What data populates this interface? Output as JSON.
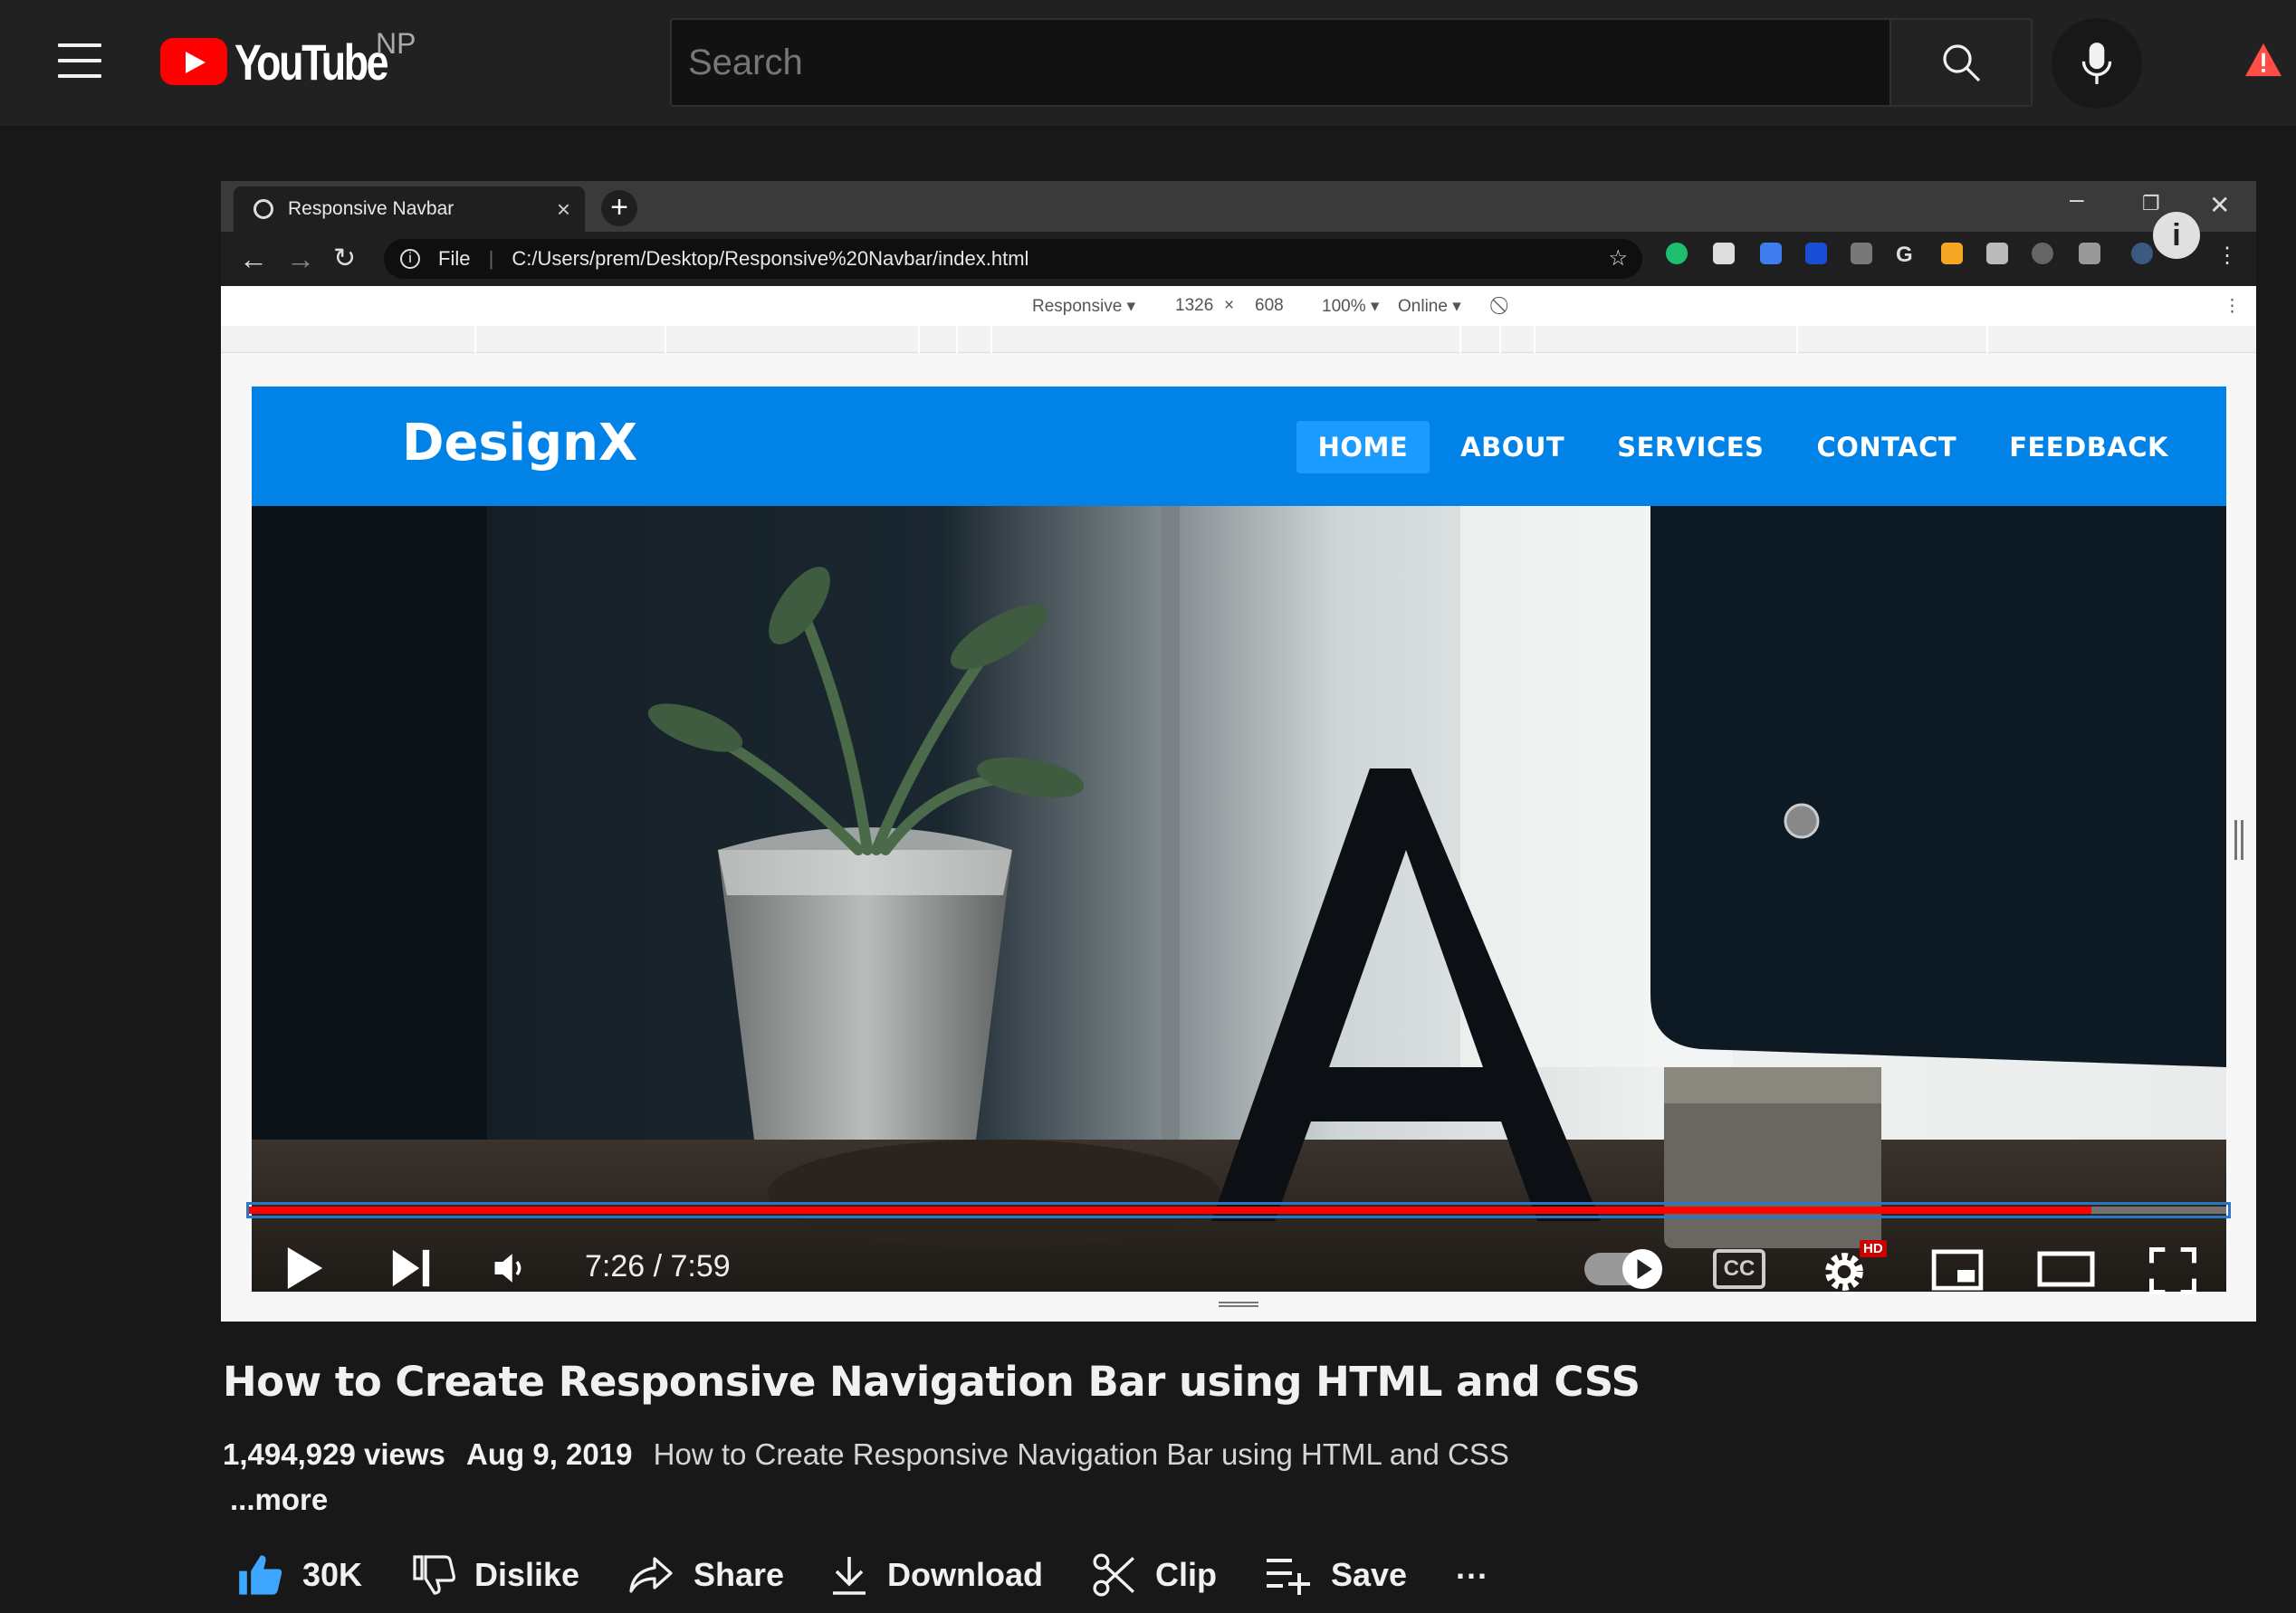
{
  "header": {
    "logo_text": "YouTube",
    "country_code": "NP",
    "search_placeholder": "Search"
  },
  "embedded_browser": {
    "tab_title": "Responsive Navbar",
    "url_prefix": "File",
    "url": "C:/Users/prem/Desktop/Responsive%20Navbar/index.html",
    "device_mode": "Responsive",
    "width": "1326",
    "times": "×",
    "height": "608",
    "zoom": "100%",
    "network": "Online"
  },
  "site": {
    "brand": "DesignX",
    "menu": [
      "HOME",
      "ABOUT",
      "SERVICES",
      "CONTACT",
      "FEEDBACK"
    ],
    "active_index": 0
  },
  "player": {
    "time_display": "7:26 / 7:59",
    "progress_fraction": 0.931,
    "hd_badge": "HD",
    "cc_label": "CC"
  },
  "video": {
    "title": "How to Create Responsive Navigation Bar using HTML and CSS",
    "views": "1,494,929 views",
    "date": "Aug 9, 2019",
    "description": "How to Create Responsive Navigation Bar using HTML and CSS",
    "more_label": "...more"
  },
  "actions": {
    "like_count": "30K",
    "dislike_label": "Dislike",
    "share_label": "Share",
    "download_label": "Download",
    "clip_label": "Clip",
    "save_label": "Save",
    "more_label": "..."
  },
  "colors": {
    "youtube_red": "#ff0000",
    "like_blue": "#3ea6ff",
    "site_nav_blue": "#0082e6"
  }
}
